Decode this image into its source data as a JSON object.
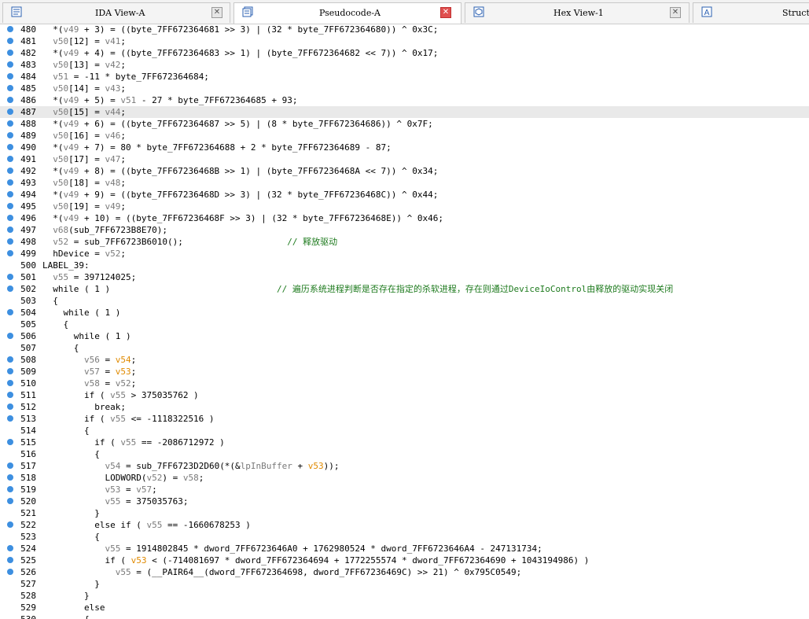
{
  "tabs": [
    {
      "title": "IDA View-A",
      "icon": "ida-view-icon",
      "active": false,
      "close_red": false
    },
    {
      "title": "Pseudocode-A",
      "icon": "pseudocode-icon",
      "active": true,
      "close_red": true
    },
    {
      "title": "Hex View-1",
      "icon": "hex-view-icon",
      "active": false,
      "close_red": false
    },
    {
      "title": "Struct",
      "icon": "structures-icon",
      "active": false,
      "close_red": false
    }
  ],
  "highlighted_line": 487,
  "lines": [
    {
      "n": "480",
      "dot": true,
      "t": [
        [
          "  *(",
          ""
        ],
        [
          "v49",
          "v"
        ],
        [
          " + 3) = ((byte_7FF672364681 >> 3) | (32 * byte_7FF672364680)) ^ 0x3C;",
          ""
        ]
      ]
    },
    {
      "n": "481",
      "dot": true,
      "t": [
        [
          "  ",
          ""
        ],
        [
          "v50",
          "v"
        ],
        [
          "[12] = ",
          ""
        ],
        [
          "v41",
          "v"
        ],
        [
          ";",
          ""
        ]
      ]
    },
    {
      "n": "482",
      "dot": true,
      "t": [
        [
          "  *(",
          ""
        ],
        [
          "v49",
          "v"
        ],
        [
          " + 4) = ((byte_7FF672364683 >> 1) | (byte_7FF672364682 << 7)) ^ 0x17;",
          ""
        ]
      ]
    },
    {
      "n": "483",
      "dot": true,
      "t": [
        [
          "  ",
          ""
        ],
        [
          "v50",
          "v"
        ],
        [
          "[13] = ",
          ""
        ],
        [
          "v42",
          "v"
        ],
        [
          ";",
          ""
        ]
      ]
    },
    {
      "n": "484",
      "dot": true,
      "t": [
        [
          "  ",
          ""
        ],
        [
          "v51",
          "v"
        ],
        [
          " = -11 * byte_7FF672364684;",
          ""
        ]
      ]
    },
    {
      "n": "485",
      "dot": true,
      "t": [
        [
          "  ",
          ""
        ],
        [
          "v50",
          "v"
        ],
        [
          "[14] = ",
          ""
        ],
        [
          "v43",
          "v"
        ],
        [
          ";",
          ""
        ]
      ]
    },
    {
      "n": "486",
      "dot": true,
      "t": [
        [
          "  *(",
          ""
        ],
        [
          "v49",
          "v"
        ],
        [
          " + 5) = ",
          ""
        ],
        [
          "v51",
          "v"
        ],
        [
          " - 27 * byte_7FF672364685 + 93;",
          ""
        ]
      ]
    },
    {
      "n": "487",
      "dot": true,
      "t": [
        [
          "  ",
          ""
        ],
        [
          "v50",
          "v"
        ],
        [
          "[15] = ",
          ""
        ],
        [
          "v44",
          "v"
        ],
        [
          ";",
          ""
        ]
      ]
    },
    {
      "n": "488",
      "dot": true,
      "t": [
        [
          "  *(",
          ""
        ],
        [
          "v49",
          "v"
        ],
        [
          " + 6) = ((byte_7FF672364687 >> 5) | (8 * byte_7FF672364686)) ^ 0x7F;",
          ""
        ]
      ]
    },
    {
      "n": "489",
      "dot": true,
      "t": [
        [
          "  ",
          ""
        ],
        [
          "v50",
          "v"
        ],
        [
          "[16] = ",
          ""
        ],
        [
          "v46",
          "v"
        ],
        [
          ";",
          ""
        ]
      ]
    },
    {
      "n": "490",
      "dot": true,
      "t": [
        [
          "  *(",
          ""
        ],
        [
          "v49",
          "v"
        ],
        [
          " + 7) = 80 * byte_7FF672364688 + 2 * byte_7FF672364689 - 87;",
          ""
        ]
      ]
    },
    {
      "n": "491",
      "dot": true,
      "t": [
        [
          "  ",
          ""
        ],
        [
          "v50",
          "v"
        ],
        [
          "[17] = ",
          ""
        ],
        [
          "v47",
          "v"
        ],
        [
          ";",
          ""
        ]
      ]
    },
    {
      "n": "492",
      "dot": true,
      "t": [
        [
          "  *(",
          ""
        ],
        [
          "v49",
          "v"
        ],
        [
          " + 8) = ((byte_7FF67236468B >> 1) | (byte_7FF67236468A << 7)) ^ 0x34;",
          ""
        ]
      ]
    },
    {
      "n": "493",
      "dot": true,
      "t": [
        [
          "  ",
          ""
        ],
        [
          "v50",
          "v"
        ],
        [
          "[18] = ",
          ""
        ],
        [
          "v48",
          "v"
        ],
        [
          ";",
          ""
        ]
      ]
    },
    {
      "n": "494",
      "dot": true,
      "t": [
        [
          "  *(",
          ""
        ],
        [
          "v49",
          "v"
        ],
        [
          " + 9) = ((byte_7FF67236468D >> 3) | (32 * byte_7FF67236468C)) ^ 0x44;",
          ""
        ]
      ]
    },
    {
      "n": "495",
      "dot": true,
      "t": [
        [
          "  ",
          ""
        ],
        [
          "v50",
          "v"
        ],
        [
          "[19] = ",
          ""
        ],
        [
          "v49",
          "v"
        ],
        [
          ";",
          ""
        ]
      ]
    },
    {
      "n": "496",
      "dot": true,
      "t": [
        [
          "  *(",
          ""
        ],
        [
          "v49",
          "v"
        ],
        [
          " + 10) = ((byte_7FF67236468F >> 3) | (32 * byte_7FF67236468E)) ^ 0x46;",
          ""
        ]
      ]
    },
    {
      "n": "497",
      "dot": true,
      "t": [
        [
          "  ",
          ""
        ],
        [
          "v68",
          "v"
        ],
        [
          "(sub_7FF6723B8E70);",
          ""
        ]
      ]
    },
    {
      "n": "498",
      "dot": true,
      "t": [
        [
          "  ",
          ""
        ],
        [
          "v52",
          "v"
        ],
        [
          " = sub_7FF6723B6010();                    ",
          ""
        ],
        [
          "// 释放驱动",
          "cm"
        ]
      ]
    },
    {
      "n": "499",
      "dot": true,
      "t": [
        [
          "  hDevice = ",
          ""
        ],
        [
          "v52",
          "v"
        ],
        [
          ";",
          ""
        ]
      ]
    },
    {
      "n": "500",
      "dot": false,
      "t": [
        [
          "LABEL_39:",
          ""
        ]
      ]
    },
    {
      "n": "501",
      "dot": true,
      "t": [
        [
          "  ",
          ""
        ],
        [
          "v55",
          "v"
        ],
        [
          " = 397124025;",
          ""
        ]
      ]
    },
    {
      "n": "502",
      "dot": true,
      "t": [
        [
          "  while ( 1 )                                ",
          ""
        ],
        [
          "// 遍历系统进程判断是否存在指定的杀软进程，存在则通过DeviceIoControl由释放的驱动实现关闭",
          "cm"
        ]
      ]
    },
    {
      "n": "503",
      "dot": false,
      "t": [
        [
          "  {",
          ""
        ]
      ]
    },
    {
      "n": "504",
      "dot": true,
      "t": [
        [
          "    while ( 1 )",
          ""
        ]
      ]
    },
    {
      "n": "505",
      "dot": false,
      "t": [
        [
          "    {",
          ""
        ]
      ]
    },
    {
      "n": "506",
      "dot": true,
      "t": [
        [
          "      while ( 1 )",
          ""
        ]
      ]
    },
    {
      "n": "507",
      "dot": false,
      "t": [
        [
          "      {",
          ""
        ]
      ]
    },
    {
      "n": "508",
      "dot": true,
      "t": [
        [
          "        ",
          ""
        ],
        [
          "v56",
          "v"
        ],
        [
          " = ",
          ""
        ],
        [
          "v54",
          "g"
        ],
        [
          ";",
          ""
        ]
      ]
    },
    {
      "n": "509",
      "dot": true,
      "t": [
        [
          "        ",
          ""
        ],
        [
          "v57",
          "v"
        ],
        [
          " = ",
          ""
        ],
        [
          "v53",
          "g"
        ],
        [
          ";",
          ""
        ]
      ]
    },
    {
      "n": "510",
      "dot": true,
      "t": [
        [
          "        ",
          ""
        ],
        [
          "v58",
          "v"
        ],
        [
          " = ",
          ""
        ],
        [
          "v52",
          "v"
        ],
        [
          ";",
          ""
        ]
      ]
    },
    {
      "n": "511",
      "dot": true,
      "t": [
        [
          "        if ( ",
          ""
        ],
        [
          "v55",
          "v"
        ],
        [
          " > 375035762 )",
          ""
        ]
      ]
    },
    {
      "n": "512",
      "dot": true,
      "t": [
        [
          "          break;",
          ""
        ]
      ]
    },
    {
      "n": "513",
      "dot": true,
      "t": [
        [
          "        if ( ",
          ""
        ],
        [
          "v55",
          "v"
        ],
        [
          " <= -1118322516 )",
          ""
        ]
      ]
    },
    {
      "n": "514",
      "dot": false,
      "t": [
        [
          "        {",
          ""
        ]
      ]
    },
    {
      "n": "515",
      "dot": true,
      "t": [
        [
          "          if ( ",
          ""
        ],
        [
          "v55",
          "v"
        ],
        [
          " == -2086712972 )",
          ""
        ]
      ]
    },
    {
      "n": "516",
      "dot": false,
      "t": [
        [
          "          {",
          ""
        ]
      ]
    },
    {
      "n": "517",
      "dot": true,
      "t": [
        [
          "            ",
          ""
        ],
        [
          "v54",
          "v"
        ],
        [
          " = sub_7FF6723D2D60(*(&",
          ""
        ],
        [
          "lpInBuffer",
          "v"
        ],
        [
          " + ",
          ""
        ],
        [
          "v53",
          "g"
        ],
        [
          "));",
          ""
        ]
      ]
    },
    {
      "n": "518",
      "dot": true,
      "t": [
        [
          "            LODWORD(",
          ""
        ],
        [
          "v52",
          "v"
        ],
        [
          ") = ",
          ""
        ],
        [
          "v58",
          "v"
        ],
        [
          ";",
          ""
        ]
      ]
    },
    {
      "n": "519",
      "dot": true,
      "t": [
        [
          "            ",
          ""
        ],
        [
          "v53",
          "v"
        ],
        [
          " = ",
          ""
        ],
        [
          "v57",
          "v"
        ],
        [
          ";",
          ""
        ]
      ]
    },
    {
      "n": "520",
      "dot": true,
      "t": [
        [
          "            ",
          ""
        ],
        [
          "v55",
          "v"
        ],
        [
          " = 375035763;",
          ""
        ]
      ]
    },
    {
      "n": "521",
      "dot": false,
      "t": [
        [
          "          }",
          ""
        ]
      ]
    },
    {
      "n": "522",
      "dot": true,
      "t": [
        [
          "          else if ( ",
          ""
        ],
        [
          "v55",
          "v"
        ],
        [
          " == -1660678253 )",
          ""
        ]
      ]
    },
    {
      "n": "523",
      "dot": false,
      "t": [
        [
          "          {",
          ""
        ]
      ]
    },
    {
      "n": "524",
      "dot": true,
      "t": [
        [
          "            ",
          ""
        ],
        [
          "v55",
          "v"
        ],
        [
          " = 1914802845 * dword_7FF6723646A0 + 1762980524 * dword_7FF6723646A4 - 247131734;",
          ""
        ]
      ]
    },
    {
      "n": "525",
      "dot": true,
      "t": [
        [
          "            if ( ",
          ""
        ],
        [
          "v53",
          "g"
        ],
        [
          " < (-714081697 * dword_7FF672364694 + 1772255574 * dword_7FF672364690 + 1043194986) )",
          ""
        ]
      ]
    },
    {
      "n": "526",
      "dot": true,
      "t": [
        [
          "              ",
          ""
        ],
        [
          "v55",
          "v"
        ],
        [
          " = (__PAIR64__(dword_7FF672364698, dword_7FF67236469C) >> 21) ^ 0x795C0549;",
          ""
        ]
      ]
    },
    {
      "n": "527",
      "dot": false,
      "t": [
        [
          "          }",
          ""
        ]
      ]
    },
    {
      "n": "528",
      "dot": false,
      "t": [
        [
          "        }",
          ""
        ]
      ]
    },
    {
      "n": "529",
      "dot": false,
      "t": [
        [
          "        else",
          ""
        ]
      ]
    },
    {
      "n": "530",
      "dot": false,
      "t": [
        [
          "        {",
          ""
        ]
      ]
    }
  ]
}
